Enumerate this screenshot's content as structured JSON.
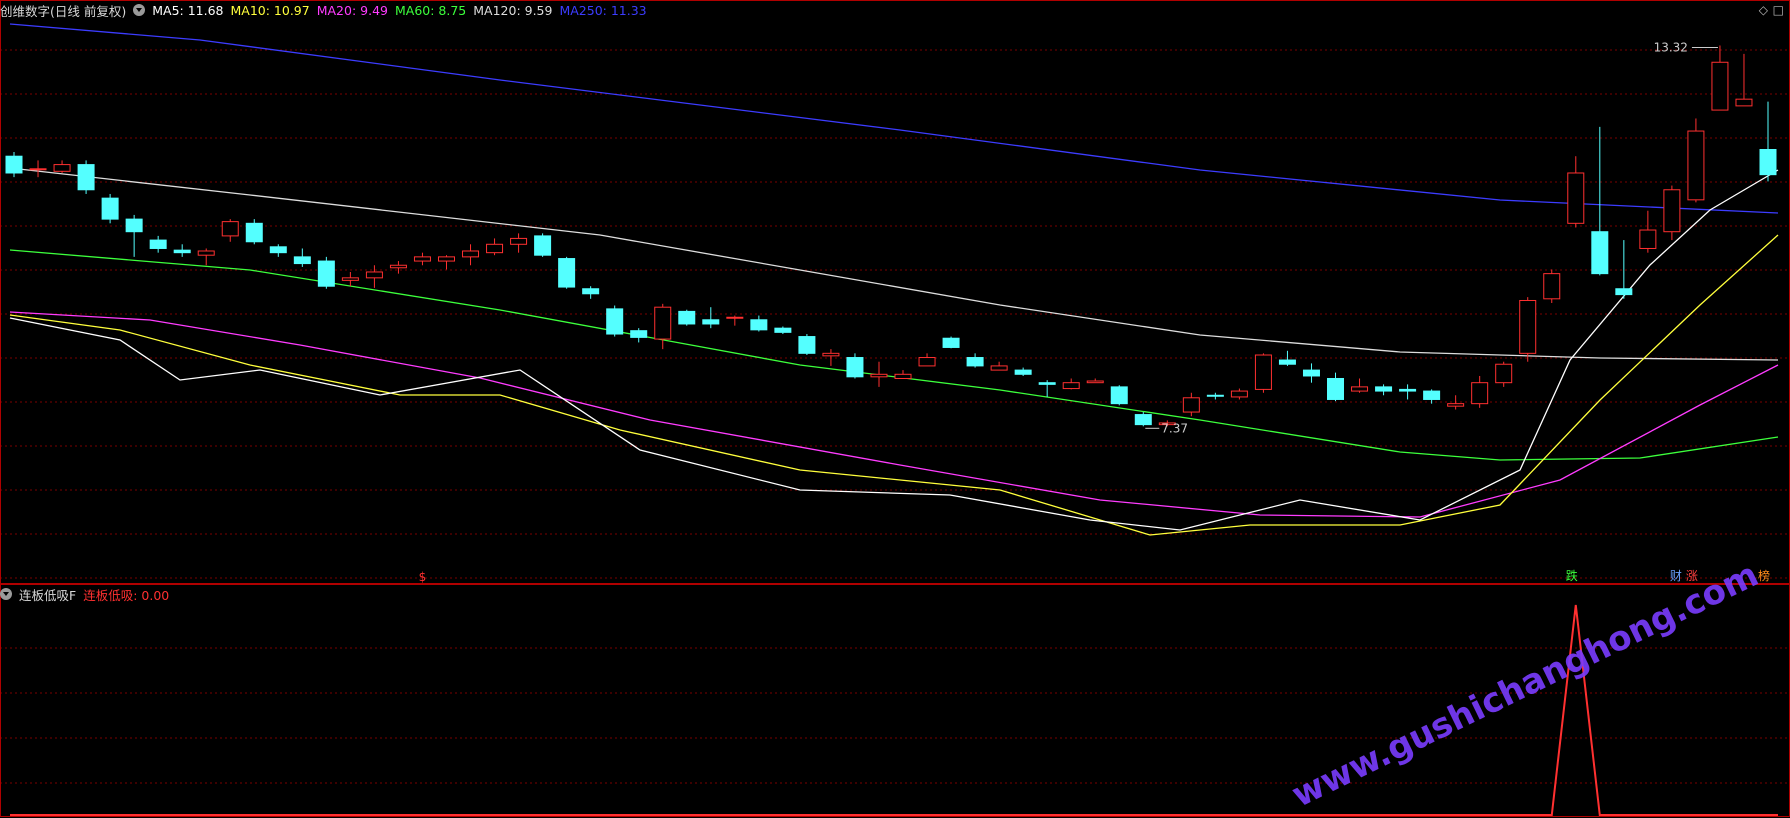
{
  "main_panel": {
    "title": "创维数字(日线 前复权)",
    "indicators": [
      {
        "label": "MA5: 11.68",
        "color": "#ffffff"
      },
      {
        "label": "MA10: 10.97",
        "color": "#ffff3c"
      },
      {
        "label": "MA20: 9.49",
        "color": "#ff3cff"
      },
      {
        "label": "MA60: 8.75",
        "color": "#3cff3c"
      },
      {
        "label": "MA120: 9.59",
        "color": "#dddddd"
      },
      {
        "label": "MA250: 11.33",
        "color": "#3c3cff"
      }
    ],
    "high_label": "13.32",
    "low_label": "7.37",
    "date_marker": "$",
    "events": [
      {
        "text": "跌",
        "color": "#3cff3c"
      },
      {
        "text": "财",
        "color": "#6aa0ff"
      },
      {
        "text": "涨",
        "color": "#ff4040"
      },
      {
        "text": "榜",
        "color": "#ff8c1a"
      }
    ],
    "corner_icons": [
      "◇",
      "□"
    ]
  },
  "sub_panel": {
    "title": "连板低吸F",
    "indicator": {
      "label": "连板低吸: 0.00",
      "color": "#ff3030"
    }
  },
  "watermark": "www.gushichanghong.com",
  "colors": {
    "up": "#ff3030",
    "down": "#54ffff",
    "grid": "#7a0000",
    "frame": "#b00000"
  },
  "chart_data": {
    "type": "candlestick",
    "price_range": [
      6.9,
      13.6
    ],
    "candles": [
      [
        12.0,
        11.8,
        12.05,
        11.75
      ],
      [
        11.85,
        11.85,
        11.95,
        11.75
      ],
      [
        11.82,
        11.9,
        11.95,
        11.8
      ],
      [
        11.9,
        11.6,
        11.95,
        11.55
      ],
      [
        11.5,
        11.25,
        11.55,
        11.2
      ],
      [
        11.25,
        11.1,
        11.3,
        10.8
      ],
      [
        11.0,
        10.9,
        11.05,
        10.85
      ],
      [
        10.88,
        10.85,
        10.95,
        10.8
      ],
      [
        10.82,
        10.87,
        10.9,
        10.7
      ],
      [
        11.05,
        11.22,
        11.25,
        10.98
      ],
      [
        11.2,
        10.98,
        11.25,
        10.95
      ],
      [
        10.92,
        10.85,
        10.95,
        10.8
      ],
      [
        10.8,
        10.72,
        10.9,
        10.68
      ],
      [
        10.75,
        10.45,
        10.8,
        10.42
      ],
      [
        10.52,
        10.55,
        10.62,
        10.45
      ],
      [
        10.55,
        10.62,
        10.7,
        10.43
      ],
      [
        10.67,
        10.7,
        10.75,
        10.6
      ],
      [
        10.75,
        10.8,
        10.85,
        10.7
      ],
      [
        10.75,
        10.8,
        10.82,
        10.65
      ],
      [
        10.8,
        10.87,
        10.95,
        10.7
      ],
      [
        10.85,
        10.95,
        11.02,
        10.82
      ],
      [
        10.95,
        11.02,
        11.08,
        10.85
      ],
      [
        11.05,
        10.82,
        11.08,
        10.8
      ],
      [
        10.78,
        10.44,
        10.8,
        10.42
      ],
      [
        10.42,
        10.36,
        10.45,
        10.3
      ],
      [
        10.18,
        9.88,
        10.22,
        9.85
      ],
      [
        9.92,
        9.84,
        9.95,
        9.78
      ],
      [
        9.82,
        10.2,
        10.24,
        9.7
      ],
      [
        10.15,
        10.0,
        10.17,
        9.98
      ],
      [
        10.05,
        10.0,
        10.2,
        9.95
      ],
      [
        10.08,
        10.08,
        10.1,
        9.98
      ],
      [
        10.05,
        9.93,
        10.1,
        9.91
      ],
      [
        9.95,
        9.9,
        9.97,
        9.88
      ],
      [
        9.85,
        9.65,
        9.88,
        9.63
      ],
      [
        9.62,
        9.65,
        9.7,
        9.5
      ],
      [
        9.6,
        9.37,
        9.65,
        9.35
      ],
      [
        9.37,
        9.4,
        9.55,
        9.25
      ],
      [
        9.35,
        9.4,
        9.45,
        9.35
      ],
      [
        9.5,
        9.6,
        9.65,
        9.5
      ],
      [
        9.83,
        9.72,
        9.85,
        9.71
      ],
      [
        9.6,
        9.5,
        9.65,
        9.48
      ],
      [
        9.45,
        9.5,
        9.55,
        9.45
      ],
      [
        9.45,
        9.4,
        9.48,
        9.38
      ],
      [
        9.3,
        9.28,
        9.33,
        9.13
      ],
      [
        9.23,
        9.3,
        9.35,
        9.22
      ],
      [
        9.3,
        9.32,
        9.35,
        9.3
      ],
      [
        9.25,
        9.05,
        9.27,
        9.03
      ],
      [
        8.92,
        8.8,
        8.95,
        8.78
      ],
      [
        8.8,
        8.82,
        8.85,
        8.78
      ],
      [
        8.95,
        9.12,
        9.18,
        8.9
      ],
      [
        9.15,
        9.14,
        9.18,
        9.1
      ],
      [
        9.13,
        9.2,
        9.23,
        9.1
      ],
      [
        9.22,
        9.63,
        9.65,
        9.18
      ],
      [
        9.57,
        9.52,
        9.68,
        9.5
      ],
      [
        9.45,
        9.38,
        9.53,
        9.3
      ],
      [
        9.35,
        9.1,
        9.42,
        9.08
      ],
      [
        9.2,
        9.25,
        9.35,
        9.18
      ],
      [
        9.25,
        9.2,
        9.28,
        9.15
      ],
      [
        9.22,
        9.2,
        9.28,
        9.1
      ],
      [
        9.2,
        9.1,
        9.22,
        9.05
      ],
      [
        9.02,
        9.05,
        9.15,
        8.98
      ],
      [
        9.05,
        9.3,
        9.38,
        9.0
      ],
      [
        9.3,
        9.52,
        9.55,
        9.25
      ],
      [
        9.65,
        10.28,
        10.32,
        9.55
      ],
      [
        10.3,
        10.6,
        10.65,
        10.25
      ],
      [
        11.2,
        11.8,
        12.0,
        11.15
      ],
      [
        11.1,
        10.6,
        12.35,
        10.58
      ],
      [
        10.42,
        10.35,
        11.0,
        10.3
      ],
      [
        10.9,
        11.12,
        11.35,
        10.85
      ],
      [
        11.1,
        11.6,
        11.65,
        11.0
      ],
      [
        11.48,
        12.3,
        12.45,
        11.45
      ],
      [
        12.55,
        13.12,
        13.32,
        12.55
      ],
      [
        12.6,
        12.68,
        13.22,
        12.6
      ],
      [
        12.08,
        11.78,
        12.65,
        11.7
      ]
    ]
  }
}
